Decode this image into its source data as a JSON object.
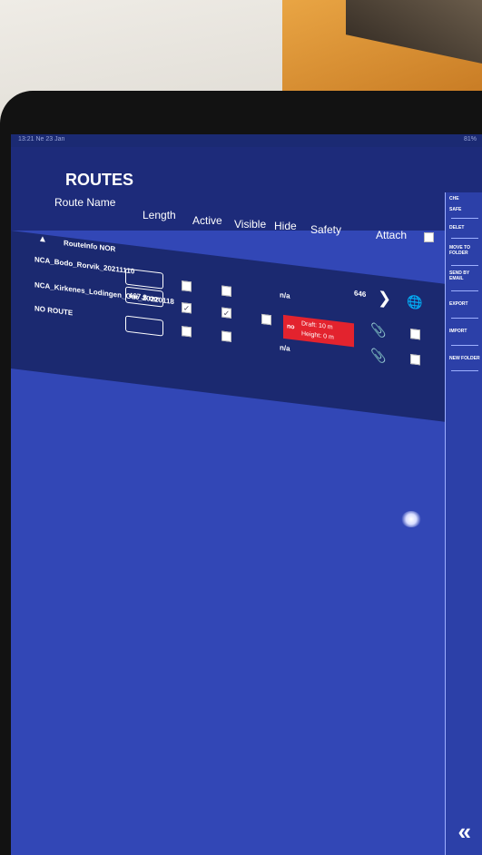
{
  "statusbar": {
    "left": "13:21 Ne 23 Jan",
    "right": "81%"
  },
  "title": "ROUTES",
  "headers": {
    "route_name": "Route Name",
    "length": "Length",
    "active": "Active",
    "visible": "Visible",
    "hide": "Hide",
    "safety": "Safety",
    "attach": "Attach"
  },
  "folder": {
    "label": "RouteInfo NOR"
  },
  "rows": [
    {
      "name": "NCA_Bodo_Rorvik_20211110",
      "length": "",
      "active": false,
      "visible": false,
      "hide": false,
      "safety": "n/a",
      "count": "646"
    },
    {
      "name": "NCA_Kirkenes_Lodingen_Out_20220118",
      "length": "467.8 nm",
      "active": true,
      "visible": true,
      "hide": false,
      "safety_no": "no",
      "draft": "Draft: 10 m",
      "height": "Height: 0 m"
    },
    {
      "name": "NO ROUTE",
      "length": "",
      "active": false,
      "visible": false,
      "hide": false,
      "safety": "n/a"
    }
  ],
  "sidebar": {
    "items": [
      "CHE",
      "SAFE",
      "DELET",
      "MOVE TO FOLDER",
      "SEND BY EMAIL",
      "EXPORT",
      "IMPORT",
      "NEW FOLDER"
    ]
  },
  "colors": {
    "screen": "#3247b6",
    "header": "#1d2b7a",
    "alert": "#e3232e"
  }
}
